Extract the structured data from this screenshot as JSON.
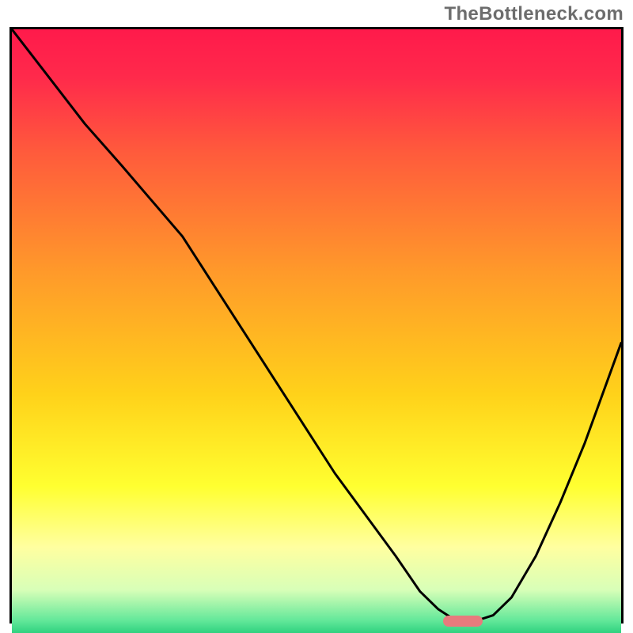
{
  "watermark": "TheBottleneck.com",
  "colors": {
    "frame": "#000000",
    "marker": "#e77b7d",
    "gradient_stops": [
      {
        "pct": 0,
        "color": "#ff1a4b"
      },
      {
        "pct": 8,
        "color": "#ff2a4b"
      },
      {
        "pct": 20,
        "color": "#ff5a3c"
      },
      {
        "pct": 40,
        "color": "#ff9a2a"
      },
      {
        "pct": 60,
        "color": "#ffd21a"
      },
      {
        "pct": 75,
        "color": "#ffff30"
      },
      {
        "pct": 85,
        "color": "#ffffa0"
      },
      {
        "pct": 92,
        "color": "#d8ffb8"
      },
      {
        "pct": 97,
        "color": "#64e89a"
      },
      {
        "pct": 100,
        "color": "#18c874"
      }
    ]
  },
  "chart_data": {
    "type": "line",
    "title": "",
    "xlabel": "",
    "ylabel": "",
    "xlim": [
      0,
      100
    ],
    "ylim": [
      0,
      100
    ],
    "series": [
      {
        "name": "curve",
        "x": [
          0,
          6,
          12,
          18,
          23,
          28,
          33,
          38,
          43,
          48,
          53,
          58,
          63,
          67,
          70,
          73,
          76,
          79,
          82,
          86,
          90,
          94,
          100
        ],
        "y": [
          100,
          92,
          84,
          77,
          71,
          65,
          57,
          49,
          41,
          33,
          25,
          18,
          11,
          5,
          2,
          0,
          0,
          1,
          4,
          11,
          20,
          30,
          47
        ]
      }
    ],
    "annotations": [
      {
        "name": "optimal-marker",
        "x": 74,
        "y": 0,
        "shape": "pill",
        "color": "#e77b7d"
      }
    ]
  }
}
